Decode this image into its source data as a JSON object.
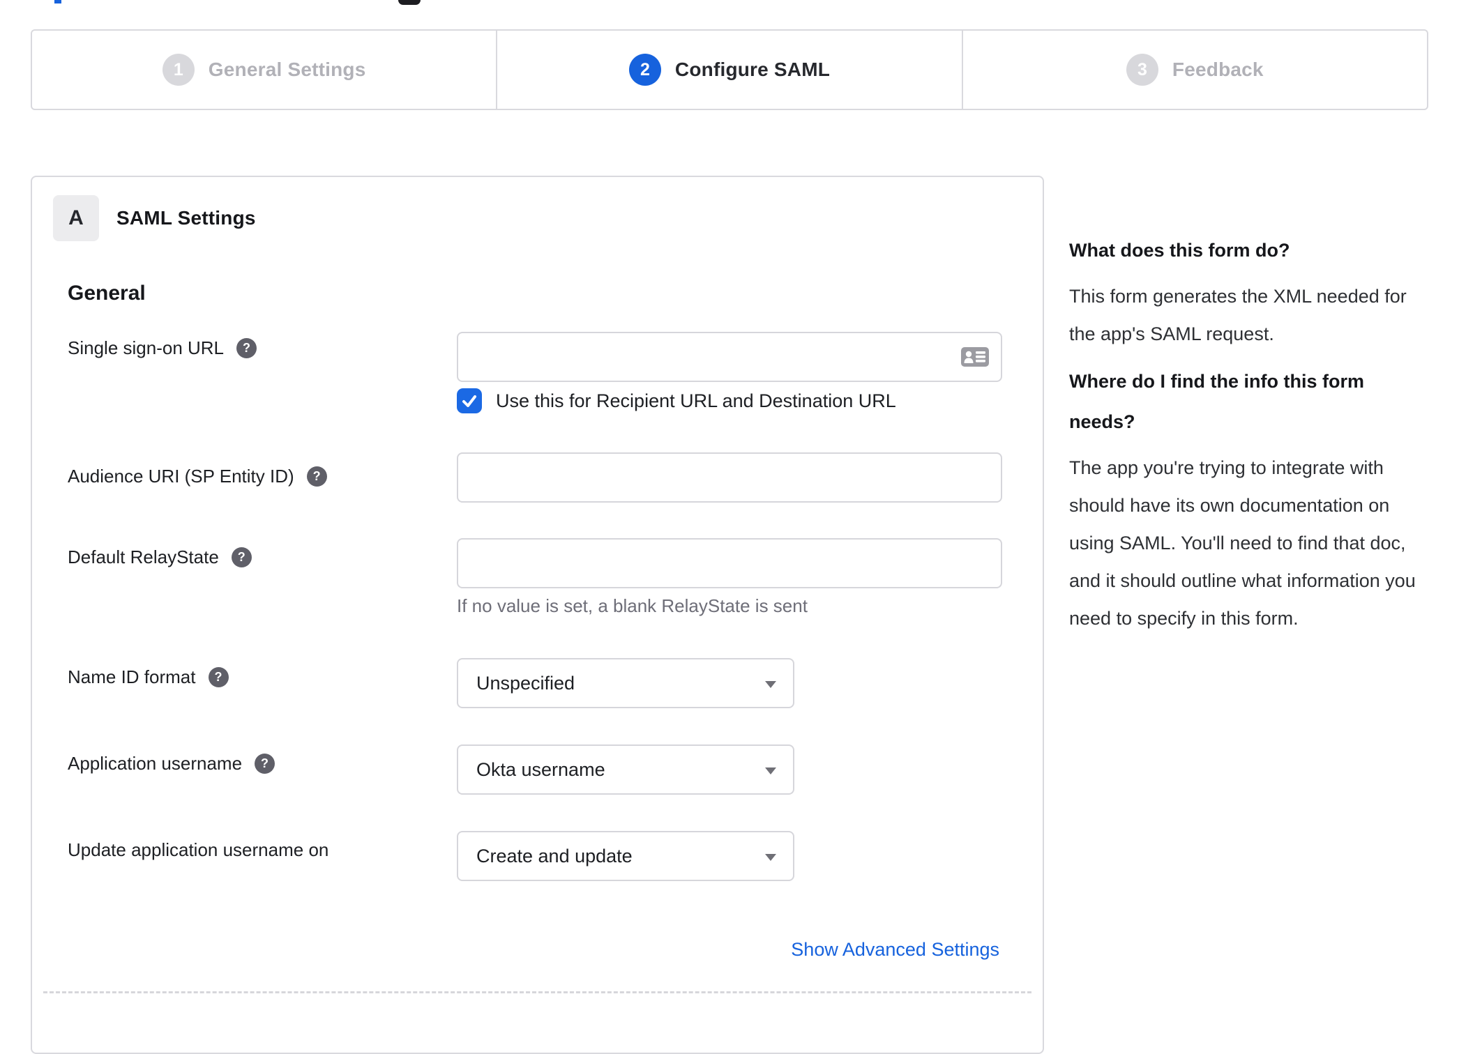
{
  "colors": {
    "accent_blue": "#1662dd",
    "link_blue": "#1662dd",
    "inactive_gray": "#d8d8dc",
    "border_gray": "#d9d9de"
  },
  "icons": {
    "help_glyph": "?",
    "contact_card": "contact-card",
    "caret": "dropdown-caret",
    "checkmark": "check"
  },
  "stepper": {
    "steps": [
      {
        "number": "1",
        "label": "General Settings",
        "state": "inactive"
      },
      {
        "number": "2",
        "label": "Configure SAML",
        "state": "active"
      },
      {
        "number": "3",
        "label": "Feedback",
        "state": "inactive"
      }
    ]
  },
  "panel": {
    "section_badge": "A",
    "section_title": "SAML Settings",
    "group_heading": "General",
    "fields": {
      "sso_url": {
        "label": "Single sign-on URL",
        "value": ""
      },
      "sso_checkbox": {
        "label": "Use this for Recipient URL and Destination URL",
        "checked": true
      },
      "audience_uri": {
        "label": "Audience URI (SP Entity ID)",
        "value": ""
      },
      "relay_state": {
        "label": "Default RelayState",
        "value": "",
        "hint": "If no value is set, a blank RelayState is sent"
      },
      "name_id_format": {
        "label": "Name ID format",
        "value": "Unspecified"
      },
      "app_username": {
        "label": "Application username",
        "value": "Okta username"
      },
      "update_app_username": {
        "label": "Update application username on",
        "value": "Create and update"
      }
    },
    "advanced_link": "Show Advanced Settings"
  },
  "sidebar": {
    "sections": [
      {
        "heading": "What does this form do?",
        "body": "This form generates the XML needed for the app's SAML request."
      },
      {
        "heading": "Where do I find the info this form needs?",
        "body": "The app you're trying to integrate with should have its own documentation on using SAML. You'll need to find that doc, and it should outline what information you need to specify in this form."
      }
    ]
  }
}
